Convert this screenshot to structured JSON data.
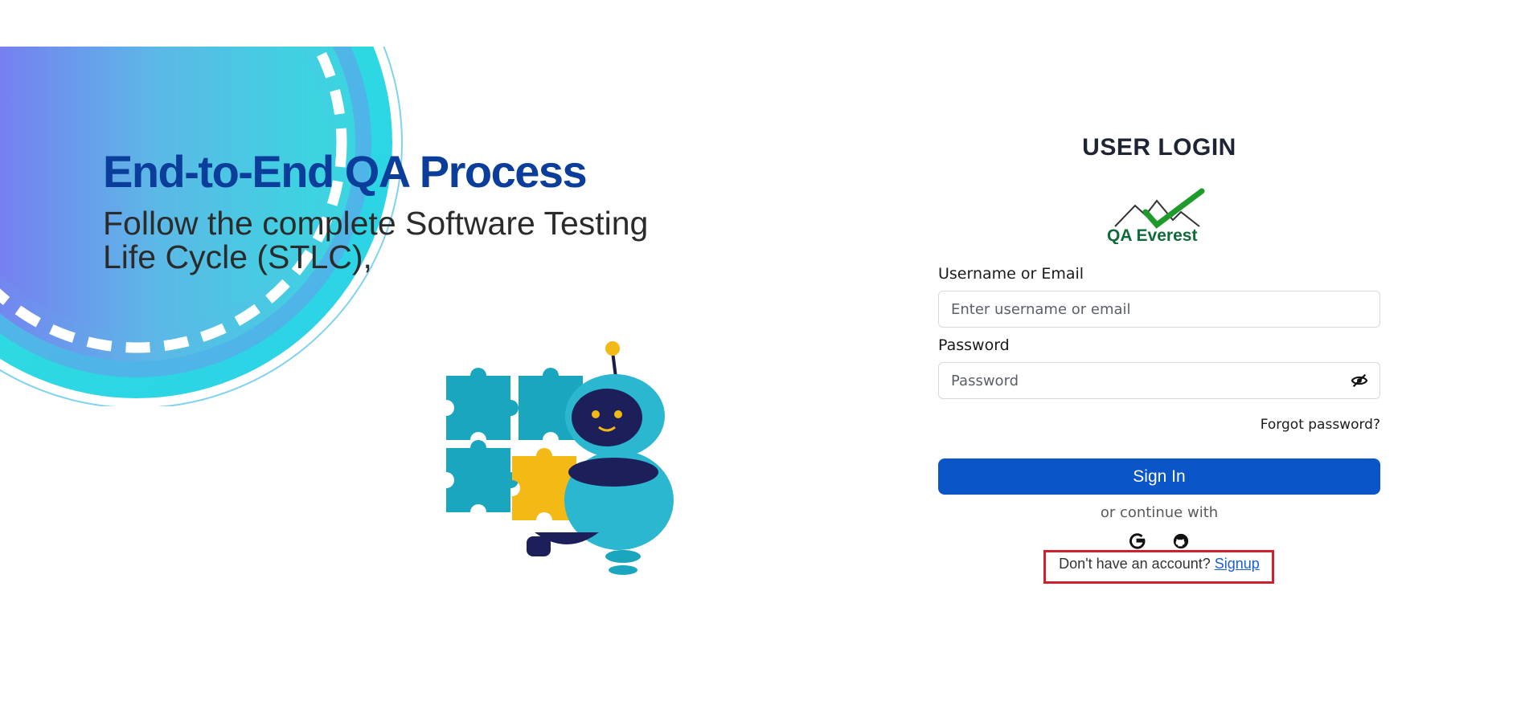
{
  "hero": {
    "title": "End-to-End QA Process",
    "subtitle": "Follow the complete Software Testing Life Cycle (STLC),",
    "illustration": "robot-with-puzzle-pieces"
  },
  "login": {
    "title": "USER LOGIN",
    "logo_text": "QA Everest",
    "username_label": "Username or Email",
    "username_placeholder": "Enter username or email",
    "username_value": "",
    "password_label": "Password",
    "password_placeholder": "Password",
    "password_value": "",
    "password_toggle_icon": "eye-slash-icon",
    "forgot_password": "Forgot password?",
    "signin_label": "Sign In",
    "or_continue": "or continue with",
    "social": [
      "google-icon",
      "github-icon"
    ],
    "no_account_text": "Don't have an account?",
    "signup_link": "Signup"
  },
  "colors": {
    "primary_button": "#0a55c8",
    "hero_title": "#0b3d9b",
    "highlight_box": "#d0202e",
    "link": "#1a5fd0"
  }
}
